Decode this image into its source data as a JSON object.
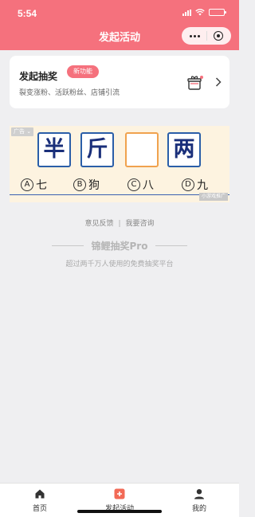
{
  "status": {
    "time": "5:54"
  },
  "nav": {
    "title": "发起活动"
  },
  "card": {
    "title": "发起抽奖",
    "badge": "新功能",
    "desc": "裂变涨粉、活跃粉丝、店铺引流"
  },
  "ad": {
    "tag": "广告",
    "chars": [
      "半",
      "斤",
      "",
      "两"
    ],
    "options": [
      {
        "letter": "A",
        "text": "七"
      },
      {
        "letter": "B",
        "text": "狗"
      },
      {
        "letter": "C",
        "text": "八"
      },
      {
        "letter": "D",
        "text": "九"
      }
    ],
    "watermark": "小游戏推广"
  },
  "footer": {
    "feedback": "意见反馈",
    "divider": "|",
    "consult": "我要咨询",
    "brand": "锦鲤抽奖Pro",
    "tagline": "超过两千万人使用的免费抽奖平台"
  },
  "tabs": [
    {
      "label": "首页",
      "icon": "home-icon"
    },
    {
      "label": "发起活动",
      "icon": "add-icon"
    },
    {
      "label": "我的",
      "icon": "user-icon"
    }
  ],
  "colors": {
    "brand": "#f5717d",
    "ad_bg": "#fdf3e0",
    "char_border": "#2a5ea8"
  }
}
